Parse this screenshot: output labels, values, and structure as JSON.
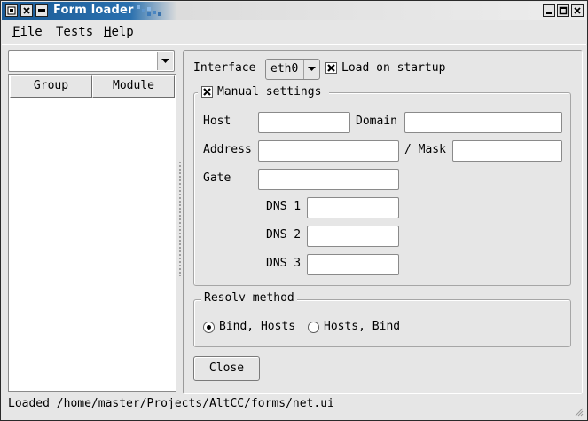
{
  "window": {
    "title": "Form loader"
  },
  "menubar": {
    "items": [
      {
        "label": "File",
        "mnemonic": "F",
        "rest": "ile"
      },
      {
        "label": "Tests",
        "mnemonic": "",
        "rest": "Tests"
      },
      {
        "label": "Help",
        "mnemonic": "H",
        "rest": "elp"
      }
    ]
  },
  "left_panel": {
    "combo_value": "",
    "columns": [
      "Group",
      "Module"
    ]
  },
  "form": {
    "interface_label": "Interface",
    "interface_value": "eth0",
    "load_on_startup_label": "Load on startup",
    "load_on_startup_checked": true,
    "manual_settings_label": "Manual settings",
    "manual_settings_checked": true,
    "host_label": "Host",
    "host_value": "",
    "domain_label": "Domain",
    "domain_value": "",
    "address_label": "Address",
    "address_value": "",
    "mask_label": "/ Mask",
    "mask_value": "",
    "gate_label": "Gate",
    "gate_value": "",
    "dns1_label": "DNS 1",
    "dns1_value": "",
    "dns2_label": "DNS 2",
    "dns2_value": "",
    "dns3_label": "DNS 3",
    "dns3_value": "",
    "resolv_title": "Resolv method",
    "resolv_options": [
      "Bind, Hosts",
      "Hosts, Bind"
    ],
    "resolv_selected": "Bind, Hosts",
    "close_label": "Close"
  },
  "status": {
    "text": "Loaded /home/master/Projects/AltCC/forms/net.ui"
  },
  "colors": {
    "titlebar_active": "#1a5a96",
    "background": "#e6e6e6"
  }
}
